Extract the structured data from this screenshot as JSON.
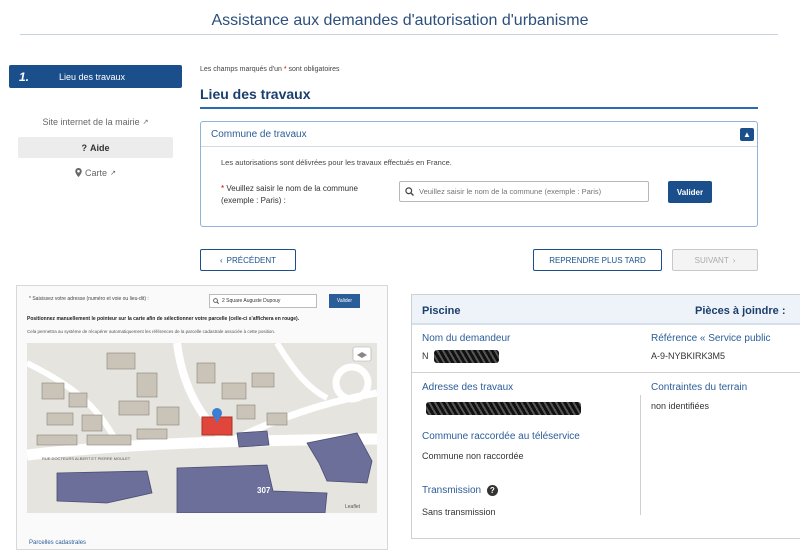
{
  "page": {
    "title": "Assistance aux demandes d'autorisation d'urbanisme"
  },
  "sidebar": {
    "step": {
      "number": "1.",
      "label": "Lieu des travaux"
    },
    "links": [
      {
        "label": "Site internet de la mairie",
        "icon": "external-link-icon"
      },
      {
        "label": "Aide",
        "icon": "question-icon"
      },
      {
        "label": "Carte",
        "icon": "map-marker-icon"
      }
    ]
  },
  "form": {
    "required_note_before": "Les champs marqués d'un",
    "required_star": "*",
    "required_note_after": "sont obligatoires",
    "section_title": "Lieu des travaux",
    "panel": {
      "title": "Commune de travaux",
      "collapse_icon": "chevron-up-icon",
      "info": "Les autorisations sont délivrées pour les travaux effectués en France.",
      "field_star": "*",
      "field_label": "Veuillez saisir le nom de la commune (exemple : Paris) :",
      "input_value": "",
      "input_placeholder": "Veuillez saisir le nom de la commune (exemple : Paris)",
      "validate_label": "Valider"
    },
    "nav": {
      "previous_label": "PRÉCÉDENT",
      "later_label": "REPRENDRE PLUS TARD",
      "next_label": "SUIVANT"
    }
  },
  "map_panel": {
    "address_label": "* Saisissez votre adresse (numéro et voie ou lieu-dit) :",
    "address_value": "2 Square Auguste Dupouy",
    "validate_label": "Valider",
    "instruction": "Positionnez manuellement le pointeur sur la carte afin de sélectionner votre parcelle (celle-ci s'affichera en rouge).",
    "sub_instruction": "Cela permettra au système de récupérer automatiquement les références de la parcelle cadastrale associée à cette position.",
    "street_label": "RUE DOCTEURS ALBERT ET PIERRE MOULET",
    "building_number": "307",
    "attribution": "Leaflet",
    "footer": "Parcelles cadastrales",
    "colors": {
      "buildings": "#6b6f9a",
      "roads": "#ffffff",
      "selected_parcel": "#e0463b",
      "ground": "#e8e6e1"
    }
  },
  "detail_card": {
    "title": "Piscine",
    "right_title": "Pièces à joindre :",
    "applicant_label": "Nom du demandeur",
    "applicant_value": "N",
    "reference_label": "Référence « Service public",
    "reference_value": "A-9-NYBKIRK3M5",
    "address_label": "Adresse des travaux",
    "constraints_label": "Contraintes du terrain",
    "constraints_value": "non identifiées",
    "commune_label": "Commune raccordée au téléservice",
    "commune_value": "Commune non raccordée",
    "transmission_label": "Transmission",
    "transmission_help": "?",
    "transmission_value": "Sans transmission"
  },
  "colors": {
    "primary": "#1b4f8c",
    "title": "#2c4f7c",
    "required": "#cc0000"
  }
}
